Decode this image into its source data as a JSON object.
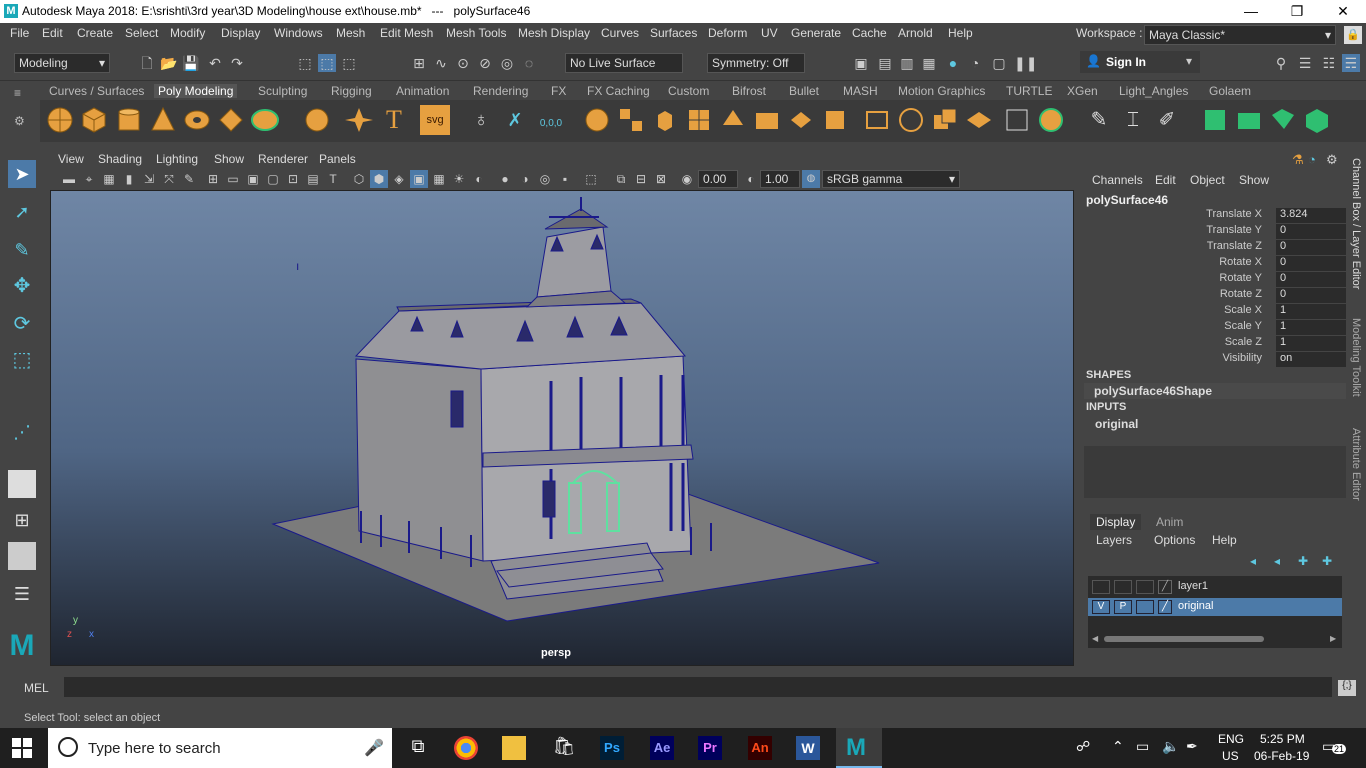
{
  "window": {
    "title": "Autodesk Maya 2018: E:\\srishti\\3rd year\\3D Modeling\\house ext\\house.mb*   ---   polySurface46",
    "minimize": "—",
    "restore": "❐",
    "close": "✕"
  },
  "menubar": {
    "items": [
      "File",
      "Edit",
      "Create",
      "Select",
      "Modify",
      "Display",
      "Windows",
      "Mesh",
      "Edit Mesh",
      "Mesh Tools",
      "Mesh Display",
      "Curves",
      "Surfaces",
      "Deform",
      "UV",
      "Generate",
      "Cache",
      "Arnold",
      "Help"
    ],
    "workspace_label": "Workspace :",
    "workspace_value": "Maya Classic*"
  },
  "toolbar": {
    "menuset": "Modeling",
    "live_surface": "No Live Surface",
    "symmetry": "Symmetry: Off",
    "sign_in": "Sign In"
  },
  "shelf": {
    "tabs": [
      "Curves / Surfaces",
      "Poly Modeling",
      "Sculpting",
      "Rigging",
      "Animation",
      "Rendering",
      "FX",
      "FX Caching",
      "Custom",
      "Bifrost",
      "Bullet",
      "MASH",
      "Motion Graphics",
      "TURTLE",
      "XGen",
      "Light_Angles",
      "Golaem"
    ],
    "active_tab": "Poly Modeling",
    "svg_label": "svg",
    "coords_label": "0,0,0"
  },
  "viewport": {
    "menu": [
      "View",
      "Shading",
      "Lighting",
      "Show",
      "Renderer",
      "Panels"
    ],
    "exposure": "0.00",
    "gamma": "1.00",
    "color_space": "sRGB gamma",
    "camera": "persp",
    "axis_y": "y",
    "axis_x": "x",
    "axis_z": "z"
  },
  "channel_box": {
    "menu": [
      "Channels",
      "Edit",
      "Object",
      "Show"
    ],
    "object": "polySurface46",
    "attributes": [
      {
        "label": "Translate X",
        "value": "3.824"
      },
      {
        "label": "Translate Y",
        "value": "0"
      },
      {
        "label": "Translate Z",
        "value": "0"
      },
      {
        "label": "Rotate X",
        "value": "0"
      },
      {
        "label": "Rotate Y",
        "value": "0"
      },
      {
        "label": "Rotate Z",
        "value": "0"
      },
      {
        "label": "Scale X",
        "value": "1"
      },
      {
        "label": "Scale Y",
        "value": "1"
      },
      {
        "label": "Scale Z",
        "value": "1"
      },
      {
        "label": "Visibility",
        "value": "on"
      }
    ],
    "shapes_header": "SHAPES",
    "shape_name": "polySurface46Shape",
    "inputs_header": "INPUTS",
    "input_name": "original"
  },
  "side_tabs": [
    "Channel Box / Layer Editor",
    "Modeling Toolkit",
    "Attribute Editor"
  ],
  "layer_editor": {
    "tabs": [
      "Display",
      "Anim"
    ],
    "active_tab": "Display",
    "menu": [
      "Layers",
      "Options",
      "Help"
    ],
    "layers": [
      {
        "name": "layer1",
        "v": "",
        "p": "",
        "selected": false
      },
      {
        "name": "original",
        "v": "V",
        "p": "P",
        "selected": true
      }
    ]
  },
  "command_line": {
    "label": "MEL"
  },
  "status_line": "Select Tool: select an object",
  "taskbar": {
    "search_placeholder": "Type here to search",
    "lang_top": "ENG",
    "lang_bottom": "US",
    "time": "5:25 PM",
    "date": "06-Feb-19",
    "notif_count": "21",
    "app_ps": "Ps",
    "app_ae": "Ae",
    "app_pr": "Pr",
    "app_an": "An",
    "app_w": "W",
    "app_m": "M"
  },
  "colors": {
    "accent": "#4c7aa8",
    "selection_green": "#5fe0a0",
    "house_outline": "#1a1a8a"
  }
}
